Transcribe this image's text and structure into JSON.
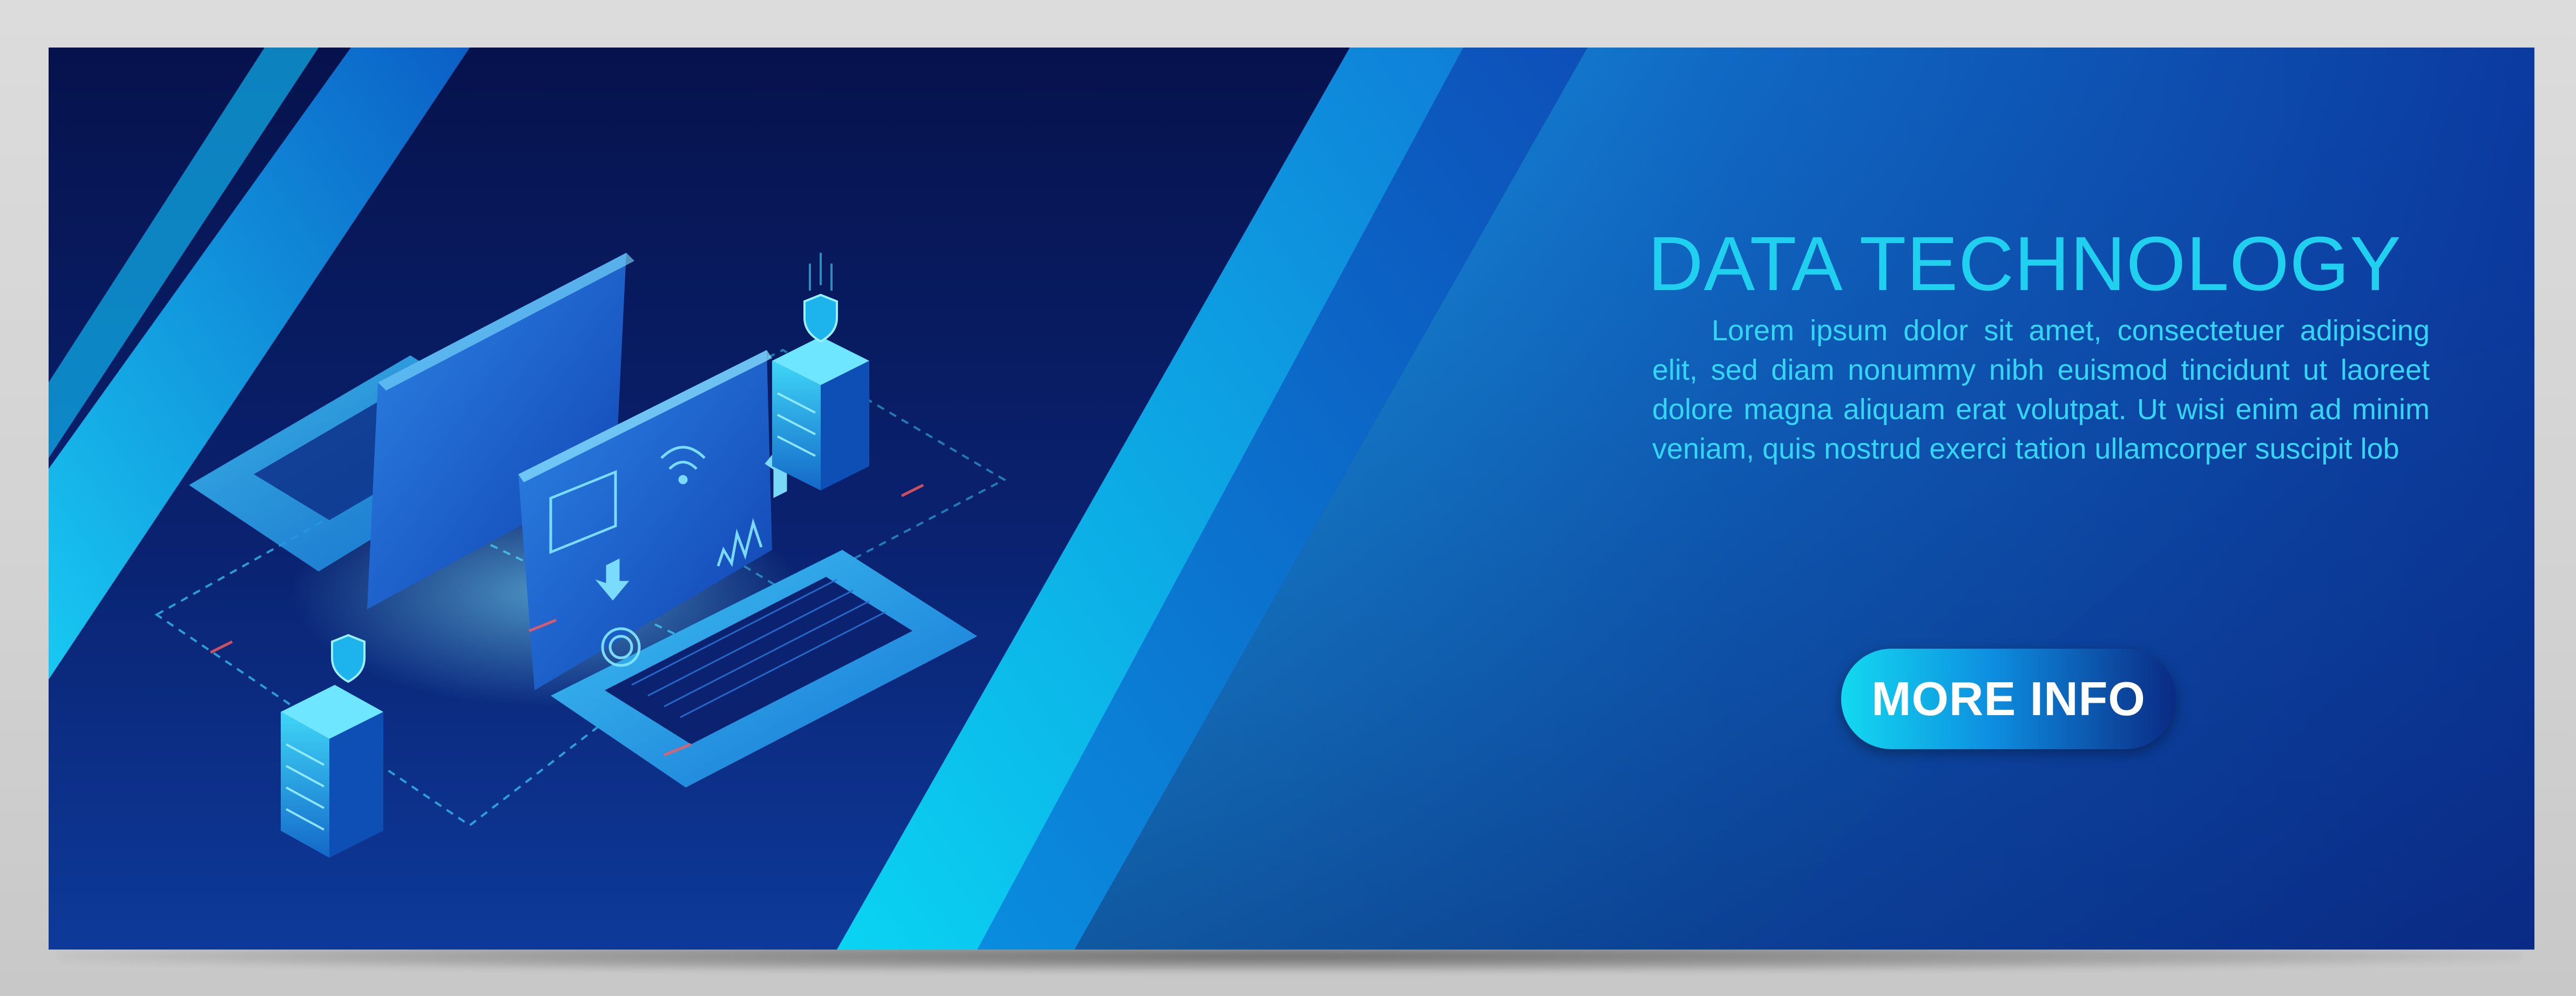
{
  "banner": {
    "title": "DATA TECHNOLOGY",
    "body": "Lorem ipsum dolor sit amet, consectetuer adipiscing elit, sed diam nonummy nibh euismod tincidunt ut laoreet dolore magna aliquam erat volutpat. Ut wisi enim ad minim veniam, quis nostrud exerci tation ullamcorper suscipit lob",
    "button_label": "MORE INFO"
  },
  "illustration": {
    "icons": [
      "laptop-icon",
      "server-icon",
      "shield-icon",
      "wifi-icon",
      "upload-arrow-icon",
      "download-arrow-icon",
      "fingerprint-icon"
    ]
  },
  "colors": {
    "background_dark": "#06124d",
    "accent_cyan": "#1fd0ef",
    "stripe_blue": "#0ea4ea",
    "button_gradient_start": "#13d9f0",
    "button_gradient_end": "#0b2a84",
    "button_text": "#ffffff"
  }
}
